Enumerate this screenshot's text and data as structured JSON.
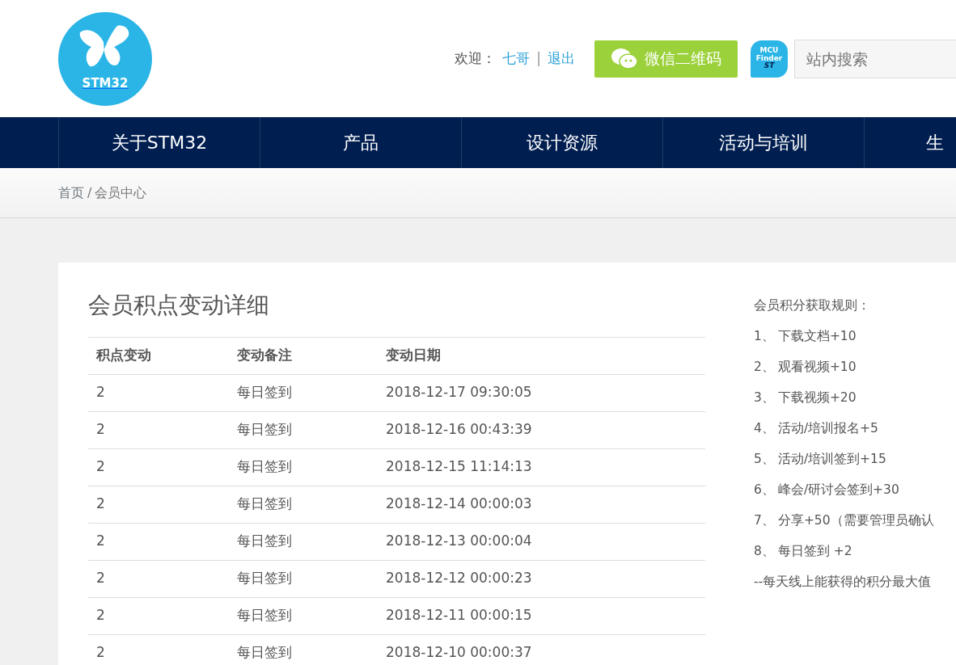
{
  "header": {
    "logo_text": "STM32",
    "welcome": "欢迎：",
    "user": "七哥",
    "separator": "|",
    "logout": "退出",
    "wechat_button": "微信二维码",
    "mcu_finder": {
      "line_1": "MCU",
      "line_2": "Finder",
      "brand": "ST"
    },
    "search": {
      "placeholder": "站内搜索"
    }
  },
  "nav": [
    {
      "label": "关于STM32"
    },
    {
      "label": "产品"
    },
    {
      "label": "设计资源"
    },
    {
      "label": "活动与培训"
    },
    {
      "label": "生"
    }
  ],
  "breadcrumb": [
    "首页",
    "会员中心"
  ],
  "breadcrumb_separator": "/",
  "title": "会员积点变动详细",
  "table": {
    "columns": [
      "积点变动",
      "变动备注",
      "变动日期"
    ],
    "rows": [
      [
        "2",
        "每日签到",
        "2018-12-17 09:30:05"
      ],
      [
        "2",
        "每日签到",
        "2018-12-16 00:43:39"
      ],
      [
        "2",
        "每日签到",
        "2018-12-15 11:14:13"
      ],
      [
        "2",
        "每日签到",
        "2018-12-14 00:00:03"
      ],
      [
        "2",
        "每日签到",
        "2018-12-13 00:00:04"
      ],
      [
        "2",
        "每日签到",
        "2018-12-12 00:00:23"
      ],
      [
        "2",
        "每日签到",
        "2018-12-11 00:00:15"
      ],
      [
        "2",
        "每日签到",
        "2018-12-10 00:00:37"
      ]
    ]
  },
  "rules": {
    "heading": "会员积分获取规则：",
    "items": [
      {
        "number": "1、",
        "text": "下载文档+10"
      },
      {
        "number": "2、",
        "text": "观看视频+10"
      },
      {
        "number": "3、",
        "text": "下载视频+20"
      },
      {
        "number": "4、",
        "text": "活动/培训报名+5"
      },
      {
        "number": "5、",
        "text": "活动/培训签到+15"
      },
      {
        "number": "6、",
        "text": "峰会/研讨会签到+30"
      },
      {
        "number": "7、",
        "text": "分享+50（需要管理员确认"
      },
      {
        "number": "8、",
        "text": "每日签到 +2"
      }
    ],
    "note": "--每天线上能获得的积分最大值"
  }
}
